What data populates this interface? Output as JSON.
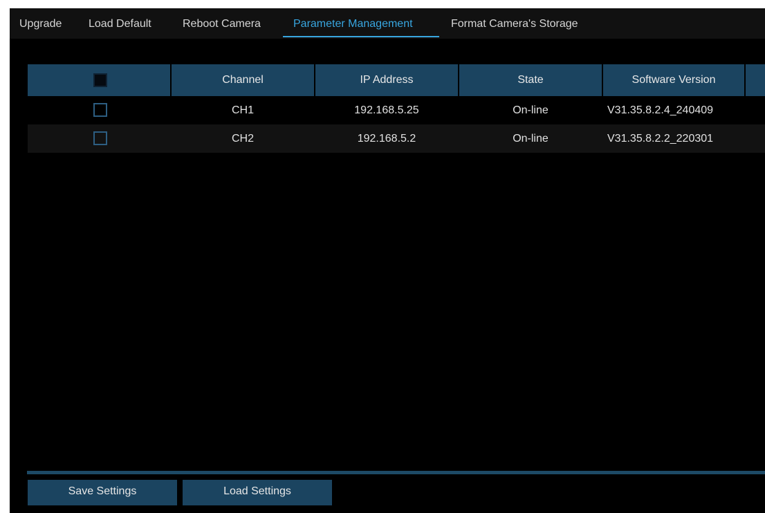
{
  "tabs": [
    {
      "label": "Upgrade"
    },
    {
      "label": "Load Default"
    },
    {
      "label": "Reboot Camera"
    },
    {
      "label": "Parameter Management"
    },
    {
      "label": "Format Camera's Storage"
    }
  ],
  "active_tab": "Parameter Management",
  "table": {
    "columns": [
      "",
      "Channel",
      "IP Address",
      "State",
      "Software Version"
    ],
    "rows": [
      {
        "channel": "CH1",
        "ip": "192.168.5.25",
        "state": "On-line",
        "version": "V31.35.8.2.4_240409"
      },
      {
        "channel": "CH2",
        "ip": "192.168.5.2",
        "state": "On-line",
        "version": "V31.35.8.2.2_220301"
      }
    ]
  },
  "buttons": {
    "save_label": "Save Settings",
    "load_label": "Load Settings"
  },
  "colors": {
    "accent": "#38a6e0",
    "header_bg": "#1b4460",
    "background": "#000000"
  }
}
